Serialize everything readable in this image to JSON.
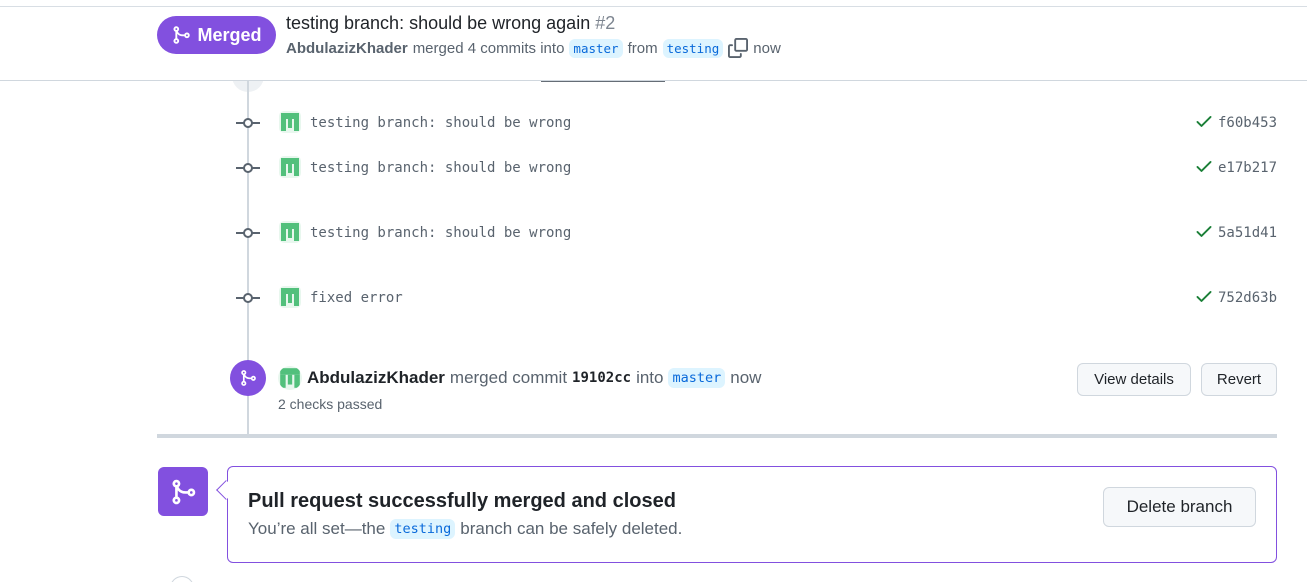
{
  "header": {
    "status_badge": "Merged",
    "title": "testing branch: should be wrong again",
    "number": "#2",
    "author": "AbdulazizKhader",
    "meta_text": "merged 4 commits into",
    "base_branch": "master",
    "from_text": "from",
    "head_branch": "testing",
    "time": "now"
  },
  "commits": [
    {
      "message": "testing branch: should be wrong",
      "sha": "f60b453",
      "icon": "check-icon"
    },
    {
      "message": "testing branch: should be wrong",
      "sha": "e17b217",
      "icon": "check-icon"
    },
    {
      "message": "testing branch: should be wrong",
      "sha": "5a51d41",
      "icon": "check-icon"
    },
    {
      "message": "fixed error",
      "sha": "752d63b",
      "icon": "check-icon"
    }
  ],
  "merge_event": {
    "author": "AbdulazizKhader",
    "text": "merged commit",
    "sha": "19102cc",
    "into_text": "into",
    "branch": "master",
    "time": "now",
    "checks": "2 checks passed",
    "view_details_label": "View details",
    "revert_label": "Revert"
  },
  "merged_box": {
    "title": "Pull request successfully merged and closed",
    "sub_prefix": "You’re all set—the",
    "branch": "testing",
    "sub_suffix": "branch can be safely deleted.",
    "delete_label": "Delete branch"
  },
  "colors": {
    "accent": "#8250df",
    "success": "#1a7f37",
    "branch_bg": "#ddf4ff",
    "branch_fg": "#0969da"
  }
}
